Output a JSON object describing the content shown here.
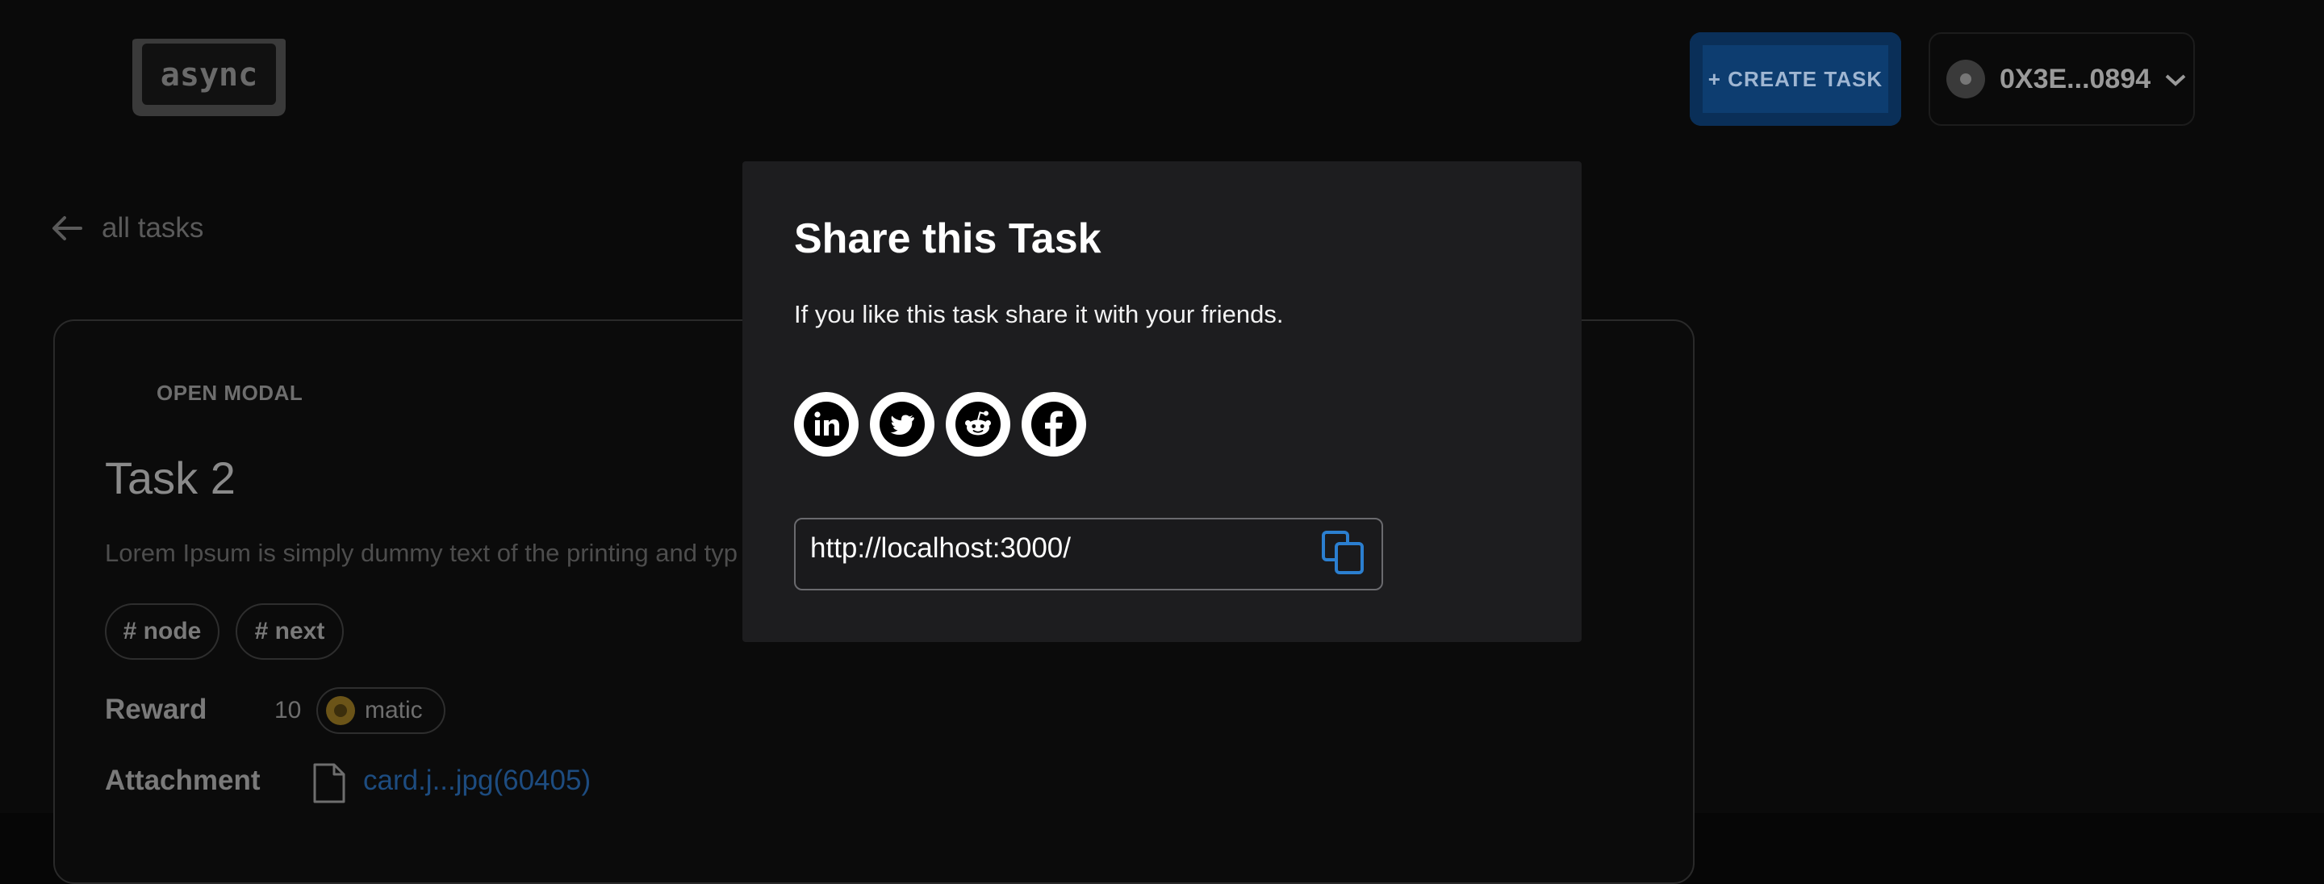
{
  "header": {
    "logo_text": "async",
    "create_task_label": "+ CREATE TASK",
    "wallet_address": "0X3E...0894"
  },
  "nav": {
    "back_label": "all tasks"
  },
  "task": {
    "open_modal_label": "OPEN MODAL",
    "title": "Task 2",
    "description": "Lorem Ipsum is simply dummy text of the printing and typ",
    "tags": [
      "# node",
      "# next"
    ],
    "reward_label": "Reward",
    "reward_value": "10",
    "reward_token": "matic",
    "attachment_label": "Attachment",
    "attachment_name": "card.j...jpg(60405)"
  },
  "modal": {
    "title": "Share this Task",
    "subtitle": "If you like this task share it with your friends.",
    "socials": [
      "linkedin-icon",
      "twitter-icon",
      "reddit-icon",
      "facebook-icon"
    ],
    "url": "http://localhost:3000/"
  },
  "colors": {
    "modal_bg": "#1d1d1f",
    "accent_blue": "#2b7fd0",
    "create_button_bg": "#0d3d70"
  }
}
